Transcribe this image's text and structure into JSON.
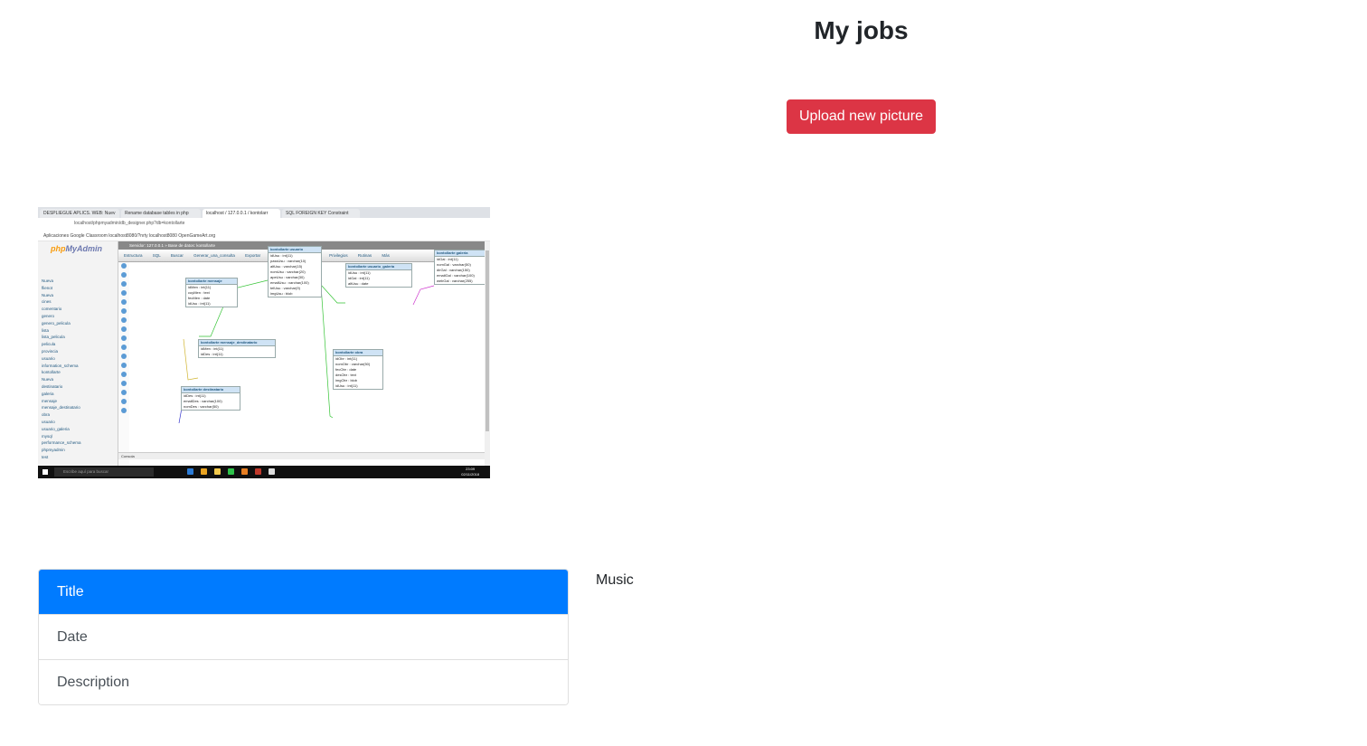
{
  "page": {
    "title": "My jobs",
    "upload_label": "Upload new picture"
  },
  "thumbnail": {
    "tabs": [
      "DESPLIEGUE APLICS. WEB: Nuev",
      "Rename database tables in php",
      "localhost / 127.0.0.1 / kontolarr",
      "SQL FOREIGN KEY Constraint"
    ],
    "url": "localhost/phpmyadmin/db_designer.php?db=kontollarte",
    "bookmarks": "Aplicaciones   Google Classroom   localhost8080/?nrty   localhost8080   OpenGameArt.org",
    "logo_left": "php",
    "logo_right": "MyAdmin",
    "server_bar": "Servidor: 127.0.0.1 » Base de datos: kontollarte",
    "menu": "Estructura SQL Buscar Generar_una_consulta Exportar Importar Operaciones Privilegios Rutinas Más",
    "tree": [
      "Nueva",
      "flienot",
      "Nueva",
      "cines",
      "comentario",
      "genero",
      "genero_pelicula",
      "lista",
      "lista_pelicula",
      "pelicula",
      "provincia",
      "usuario",
      "information_schema",
      "kontollarte",
      "Nueva",
      "destinatario",
      "galeria",
      "mensaje",
      "mensaje_destinatario",
      "obra",
      "usuario",
      "usuario_galeria",
      "mysql",
      "performance_schema",
      "phpmyadmin",
      "test"
    ],
    "tables": [
      {
        "name": "kontollarte mensaje",
        "cols": [
          "idMen : int(11)",
          "cuyMen : text",
          "fecMen : date",
          "idUsu : int(11)"
        ]
      },
      {
        "name": "kontollarte usuario",
        "cols": [
          "idUsu : int(11)",
          "passUsu : varchar(10)",
          "altUsu : varchar(15)",
          "nomUsu : varchar(20)",
          "apeUsu : varchar(30)",
          "emailUsu : varchar(100)",
          "telUsu : varchar(9)",
          "imgUsu : blob"
        ]
      },
      {
        "name": "kontollarte usuario_galeria",
        "cols": [
          "idUsu : int(11)",
          "idGal : int(11)",
          "altUsu : date"
        ]
      },
      {
        "name": "kontollarte galeria",
        "cols": [
          "idGal : int(11)",
          "nomGal : varchar(50)",
          "dirGal : varchar(150)",
          "emailGal : varchar(100)",
          "webGal : varchar(255)"
        ]
      },
      {
        "name": "kontollarte mensaje_destinatario",
        "cols": [
          "idMen : int(11)",
          "idDes : int(11)"
        ]
      },
      {
        "name": "kontollarte obra",
        "cols": [
          "idObr : int(11)",
          "nomObr : varchar(50)",
          "fecObr : date",
          "desObr : text",
          "imgObr : blob",
          "idUsu : int(11)"
        ]
      },
      {
        "name": "kontollarte destinatario",
        "cols": [
          "idDes : int(11)",
          "emailDes : varchar(100)",
          "nomDes : varchar(50)"
        ]
      }
    ],
    "console": "Consola",
    "taskbar_search": "Escribe aquí para buscar",
    "clock_time": "23:09",
    "clock_date": "02/11/2018"
  },
  "card": {
    "items": [
      "Title",
      "Date",
      "Description"
    ],
    "active_index": 0,
    "side_text": "Music"
  },
  "colors": {
    "danger": "#dc3545",
    "primary": "#007bff"
  }
}
